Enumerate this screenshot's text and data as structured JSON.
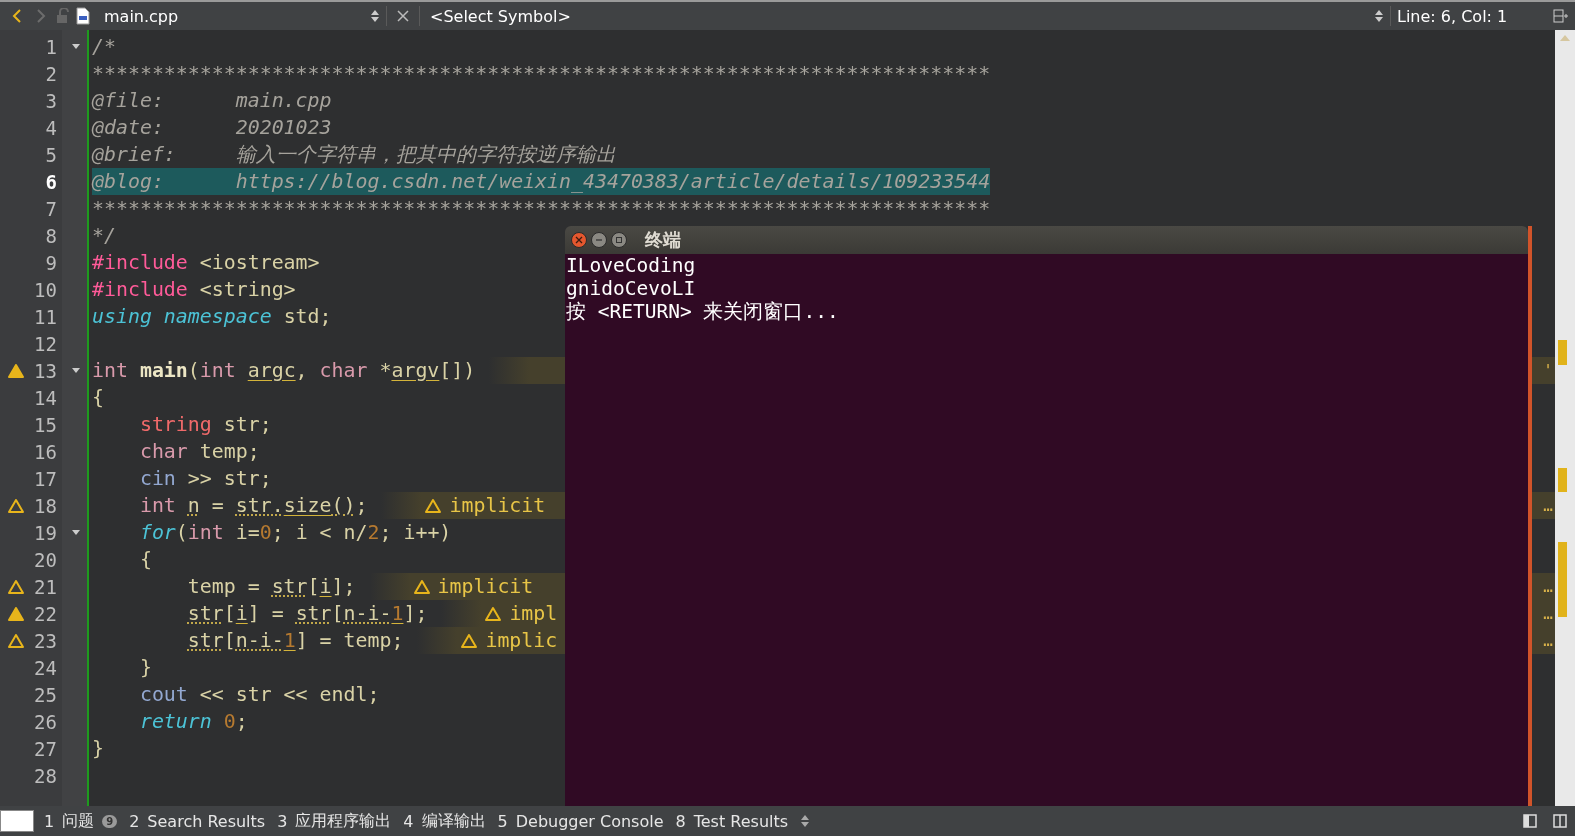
{
  "toolbar": {
    "back_enabled": true,
    "forward_enabled": false,
    "file_name": "main.cpp",
    "symbol": "<Select Symbol>",
    "position": "Line: 6, Col: 1"
  },
  "lines": [
    {
      "number": "1",
      "foldable": true,
      "tokens": [
        {
          "t": "/*",
          "kind": "comment"
        }
      ]
    },
    {
      "number": "2",
      "tokens": [
        {
          "t": "***************************************************************************",
          "kind": "comment"
        }
      ]
    },
    {
      "number": "3",
      "tokens": [
        {
          "t": "@file:      main.cpp",
          "kind": "comment"
        }
      ]
    },
    {
      "number": "4",
      "tokens": [
        {
          "t": "@date:      20201023",
          "kind": "comment"
        }
      ]
    },
    {
      "number": "5",
      "tokens": [
        {
          "t": "@brief:     输入一个字符串，把其中的字符按逆序输出",
          "kind": "comment"
        }
      ]
    },
    {
      "number": "6",
      "current": true,
      "highlighted": true,
      "tokens": [
        {
          "t": "@blog:      https://blog.csdn.net/weixin_43470383/article/details/109233544",
          "kind": "comment"
        }
      ]
    },
    {
      "number": "7",
      "tokens": [
        {
          "t": "***************************************************************************",
          "kind": "comment"
        }
      ]
    },
    {
      "number": "8",
      "tokens": [
        {
          "t": "*/",
          "kind": "comment"
        }
      ]
    },
    {
      "number": "9",
      "tokens": [
        {
          "t": "#include",
          "kind": "preproc"
        },
        {
          "t": " <iostream>",
          "kind": "plain"
        }
      ]
    },
    {
      "number": "10",
      "tokens": [
        {
          "t": "#include",
          "kind": "preproc"
        },
        {
          "t": " <string>",
          "kind": "plain"
        }
      ]
    },
    {
      "number": "11",
      "tokens": [
        {
          "t": "using ",
          "kind": "flow"
        },
        {
          "t": "namespace",
          "kind": "flow"
        },
        {
          "t": " std;",
          "kind": "plain"
        }
      ]
    },
    {
      "number": "12"
    },
    {
      "number": "13",
      "foldable": true,
      "warning": true,
      "filled": true,
      "annotation": {
        "tail": "'"
      },
      "tokens": [
        {
          "t": "int ",
          "kind": "keyword"
        },
        {
          "t": "main",
          "kind": "func"
        },
        {
          "t": "(",
          "kind": "plain"
        },
        {
          "t": "int ",
          "kind": "keyword"
        },
        {
          "t": "argc",
          "kind": "plain",
          "solid_underline": true
        },
        {
          "t": ", ",
          "kind": "plain"
        },
        {
          "t": "char",
          "kind": "keyword"
        },
        {
          "t": " *",
          "kind": "plain"
        },
        {
          "t": "argv",
          "kind": "plain",
          "solid_underline": true
        },
        {
          "t": "[])",
          "kind": "plain"
        }
      ]
    },
    {
      "number": "14",
      "tokens": [
        {
          "t": "{",
          "kind": "plain"
        }
      ]
    },
    {
      "number": "15",
      "tokens": [
        {
          "t": "    string",
          "kind": "type"
        },
        {
          "t": " str;",
          "kind": "plain"
        }
      ]
    },
    {
      "number": "16",
      "tokens": [
        {
          "t": "    char",
          "kind": "keyword"
        },
        {
          "t": " temp;",
          "kind": "plain"
        }
      ]
    },
    {
      "number": "17",
      "tokens": [
        {
          "t": "    cin",
          "kind": "stream"
        },
        {
          "t": " >> str;",
          "kind": "plain"
        }
      ]
    },
    {
      "number": "18",
      "warning": true,
      "filled": false,
      "annotation": {
        "text": "implicit",
        "tail": "…"
      },
      "tokens": [
        {
          "t": "    int ",
          "kind": "keyword"
        },
        {
          "t": "n",
          "kind": "plain",
          "dotted_underline": true
        },
        {
          "t": " = ",
          "kind": "plain"
        },
        {
          "t": "str.",
          "kind": "plain",
          "dotted_underline": true
        },
        {
          "t": "size",
          "kind": "plain",
          "solid_underline": true
        },
        {
          "t": "()",
          "kind": "plain",
          "dotted_underline": true
        },
        {
          "t": ";",
          "kind": "plain"
        }
      ]
    },
    {
      "number": "19",
      "foldable": true,
      "tokens": [
        {
          "t": "    for",
          "kind": "flow"
        },
        {
          "t": "(",
          "kind": "plain"
        },
        {
          "t": "int",
          "kind": "keyword"
        },
        {
          "t": " i=",
          "kind": "plain"
        },
        {
          "t": "0",
          "kind": "number"
        },
        {
          "t": "; i < n/",
          "kind": "plain"
        },
        {
          "t": "2",
          "kind": "number"
        },
        {
          "t": "; i++)",
          "kind": "plain"
        }
      ]
    },
    {
      "number": "20",
      "tokens": [
        {
          "t": "    {",
          "kind": "plain"
        }
      ]
    },
    {
      "number": "21",
      "warning": true,
      "filled": false,
      "annotation": {
        "text": "implicit",
        "tail": "…"
      },
      "tokens": [
        {
          "t": "        temp = ",
          "kind": "plain"
        },
        {
          "t": "str",
          "kind": "plain",
          "dotted_underline": true
        },
        {
          "t": "[",
          "kind": "plain"
        },
        {
          "t": "i",
          "kind": "plain",
          "solid_underline": true
        },
        {
          "t": "];",
          "kind": "plain"
        }
      ]
    },
    {
      "number": "22",
      "warning": true,
      "filled": true,
      "annotation": {
        "text": "impl",
        "tail": "…"
      },
      "tokens": [
        {
          "t": "        str",
          "kind": "plain",
          "dotted_underline": true
        },
        {
          "t": "[",
          "kind": "plain"
        },
        {
          "t": "i",
          "kind": "plain",
          "solid_underline": true
        },
        {
          "t": "] = ",
          "kind": "plain"
        },
        {
          "t": "str",
          "kind": "plain",
          "dotted_underline": true
        },
        {
          "t": "[",
          "kind": "plain"
        },
        {
          "t": "n-i-",
          "kind": "plain",
          "dotted_underline": true
        },
        {
          "t": "1",
          "kind": "number",
          "solid_underline": true
        },
        {
          "t": "];",
          "kind": "plain"
        }
      ]
    },
    {
      "number": "23",
      "warning": true,
      "filled": false,
      "annotation": {
        "text": "implic",
        "tail": "…"
      },
      "tokens": [
        {
          "t": "        str",
          "kind": "plain",
          "dotted_underline": true
        },
        {
          "t": "[",
          "kind": "plain"
        },
        {
          "t": "n-i-",
          "kind": "plain",
          "dotted_underline": true
        },
        {
          "t": "1",
          "kind": "number",
          "solid_underline": true
        },
        {
          "t": "] = temp;",
          "kind": "plain"
        }
      ]
    },
    {
      "number": "24",
      "tokens": [
        {
          "t": "    }",
          "kind": "plain"
        }
      ]
    },
    {
      "number": "25",
      "tokens": [
        {
          "t": "    cout",
          "kind": "stream"
        },
        {
          "t": " << str << endl;",
          "kind": "plain"
        }
      ]
    },
    {
      "number": "26",
      "tokens": [
        {
          "t": "    return ",
          "kind": "flow"
        },
        {
          "t": "0",
          "kind": "number"
        },
        {
          "t": ";",
          "kind": "plain"
        }
      ]
    },
    {
      "number": "27",
      "tokens": [
        {
          "t": "}",
          "kind": "plain"
        }
      ]
    },
    {
      "number": "28"
    }
  ],
  "terminal": {
    "title": "终端",
    "lines": [
      "ILoveCoding",
      "gnidoCevoLI",
      "按 <RETURN> 来关闭窗口..."
    ]
  },
  "status_tabs": [
    {
      "number": "1",
      "label": "问题",
      "badge": "9"
    },
    {
      "number": "2",
      "label": "Search Results"
    },
    {
      "number": "3",
      "label": "应用程序输出"
    },
    {
      "number": "4",
      "label": "编译输出"
    },
    {
      "number": "5",
      "label": "Debugger Console"
    },
    {
      "number": "8",
      "label": "Test Results"
    }
  ]
}
